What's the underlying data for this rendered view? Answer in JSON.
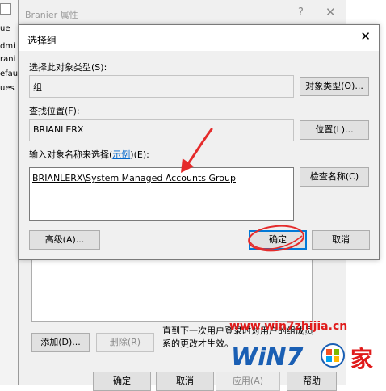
{
  "background_left": {
    "items": [
      "ue",
      "dmi",
      "rani",
      "efau",
      "ues"
    ]
  },
  "outer_window": {
    "title": "Branier 属性",
    "help": "?",
    "close": "✕",
    "note_line1": "直到下一次用户登录时对用户的组成员",
    "note_line2": "系的更改才生效。",
    "add_button": "添加(D)...",
    "remove_button": "删除(R)",
    "ok_button": "确定",
    "cancel_button": "取消",
    "apply_button": "应用(A)",
    "help_button": "帮助"
  },
  "dialog": {
    "title": "选择组",
    "close": "✕",
    "object_type_label": "选择此对象类型(S):",
    "object_type_value": "组",
    "object_type_button": "对象类型(O)...",
    "location_label": "查找位置(F):",
    "location_value": "BRIANLERX",
    "location_button": "位置(L)...",
    "names_label_prefix": "输入对象名称来选择(",
    "names_label_link": "示例",
    "names_label_suffix": ")(E):",
    "names_value": "BRIANLERX\\System Managed Accounts Group",
    "check_names_button": "检查名称(C)",
    "advanced_button": "高级(A)...",
    "ok_button": "确定",
    "cancel_button": "取消"
  },
  "watermark": {
    "url": "www.win7zhijia.cn",
    "brand": "WiN7",
    "suffix": "家"
  },
  "colors": {
    "annotation_red": "#e52b2b",
    "link_blue": "#0066cc",
    "focus_blue": "#0078d7"
  }
}
